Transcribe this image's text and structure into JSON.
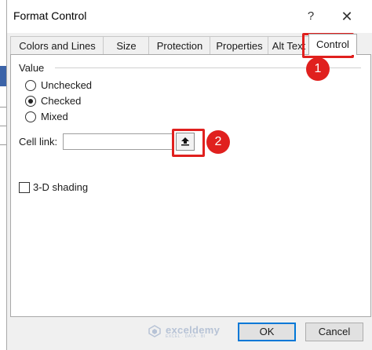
{
  "window": {
    "title": "Format Control",
    "help_label": "?",
    "close_label": "✕"
  },
  "tabs": [
    {
      "label": "Colors and Lines"
    },
    {
      "label": "Size"
    },
    {
      "label": "Protection"
    },
    {
      "label": "Properties"
    },
    {
      "label": "Alt Text"
    },
    {
      "label": "Control",
      "active": true
    }
  ],
  "value_group": {
    "label": "Value",
    "options": [
      {
        "label": "Unchecked",
        "selected": false
      },
      {
        "label": "Checked",
        "selected": true
      },
      {
        "label": "Mixed",
        "selected": false
      }
    ]
  },
  "cell_link": {
    "label": "Cell link:",
    "value": "",
    "collapse_icon": "collapse-dialog-icon"
  },
  "shading": {
    "label": "3-D shading",
    "checked": false
  },
  "watermark": {
    "text": "exceldemy",
    "subtext": "EXCEL · DATA · BI"
  },
  "buttons": {
    "ok": "OK",
    "cancel": "Cancel"
  },
  "annotations": {
    "step1": "1",
    "step2": "2",
    "highlight_color": "#e0201e"
  }
}
